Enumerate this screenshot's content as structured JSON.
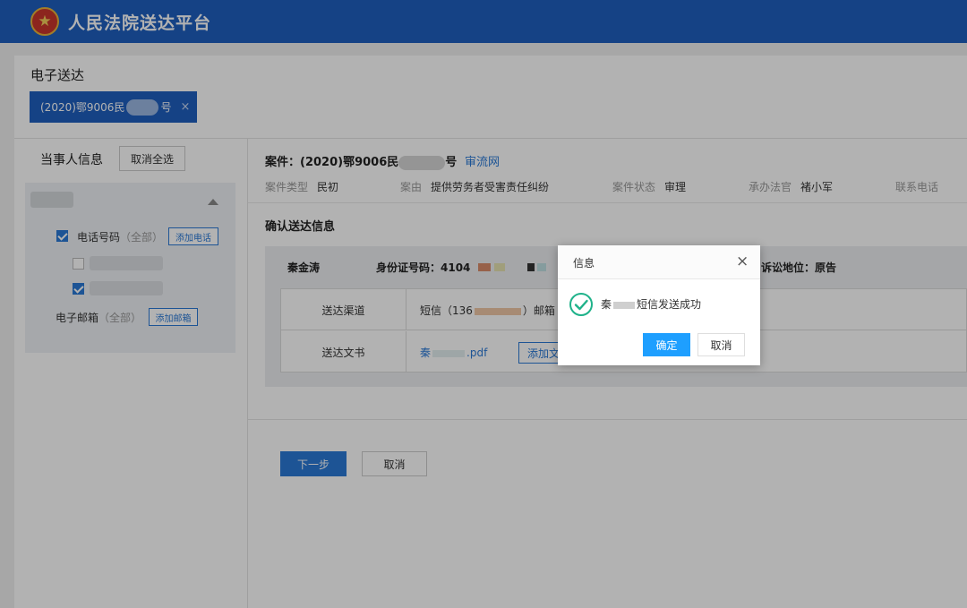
{
  "header": {
    "app_title": "人民法院送达平台",
    "emblem_icon": "court-emblem-icon"
  },
  "page": {
    "title": "电子送达",
    "case_tab": {
      "prefix": "(2020)鄂9006民",
      "suffix": "号",
      "close": "×"
    }
  },
  "sidebar": {
    "title": "当事人信息",
    "deselect_all": "取消全选",
    "phone_label": "电话号码",
    "phone_all": "（全部）",
    "add_phone": "添加电话",
    "email_label": "电子邮箱",
    "email_all": "（全部）",
    "add_email": "添加邮箱"
  },
  "case": {
    "label": "案件：",
    "number_prefix": "(2020)鄂9006民",
    "number_suffix": "号",
    "link": "审流网",
    "meta": [
      {
        "key": "案件类型",
        "value": "民初"
      },
      {
        "key": "案由",
        "value": "提供劳务者受害责任纠纷"
      },
      {
        "key": "案件状态",
        "value": "审理"
      },
      {
        "key": "承办法官",
        "value": "褚小军"
      },
      {
        "key": "联系电话",
        "value": ""
      }
    ]
  },
  "confirm": {
    "title": "确认送达信息",
    "recipient": "秦金涛",
    "id_label": "身份证号码：4104",
    "role": "诉讼地位：原告",
    "channel_label": "送达渠道",
    "channel_value_prefix": "短信（136",
    "channel_value_mid": "）邮箱",
    "doc_label": "送达文书",
    "doc_file_prefix": "秦",
    "doc_file_ext": ".pdf",
    "add_file": "添加文书"
  },
  "actions": {
    "next": "下一步",
    "cancel": "取消"
  },
  "modal": {
    "title": "信息",
    "close": "×",
    "message_prefix": "秦",
    "message_suffix": "短信发送成功",
    "ok": "确定",
    "cancel": "取消",
    "icon": "check-circle-icon"
  },
  "colors": {
    "header": "#1f5fbf",
    "primary": "#2a79d6",
    "modal_ok": "#1e9fff",
    "success": "#1fb28a"
  }
}
